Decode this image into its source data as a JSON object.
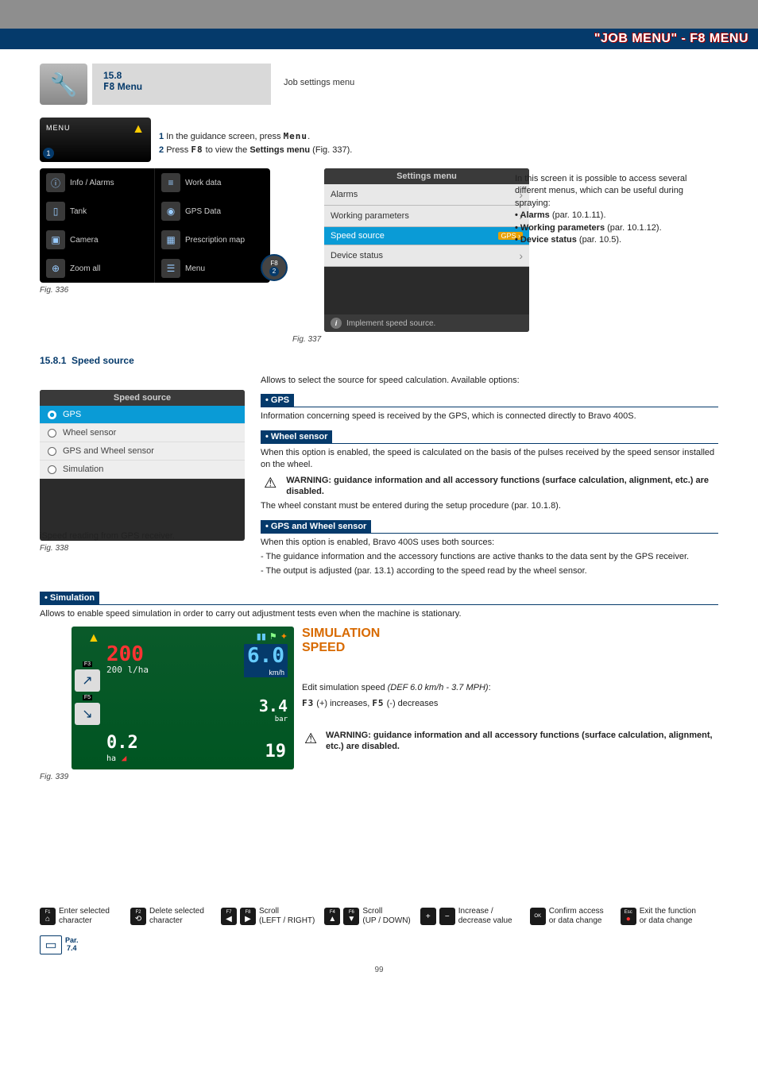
{
  "banner": "\"JOB MENU\" - F8 MENU",
  "section": {
    "num": "15.8",
    "f8": "F8",
    "menu": "Menu",
    "caption": "Job settings menu"
  },
  "menu_panel": {
    "label": "MENU",
    "badge": "1"
  },
  "instructions": {
    "s1n": "1",
    "s1a": "In the guidance screen, press ",
    "s1b": "Menu",
    "s1c": ".",
    "s2n": "2",
    "s2a": "Press ",
    "s2b": "F8",
    "s2c": " to view the ",
    "s2d": "Settings menu",
    "s2e": " (Fig. 337)."
  },
  "fig336": "Fig. 336",
  "fig337": "Fig. 337",
  "fig338": "Fig. 338",
  "fig339": "Fig. 339",
  "jobmenu": {
    "info": "Info / Alarms",
    "work": "Work data",
    "tank": "Tank",
    "gps": "GPS Data",
    "camera": "Camera",
    "rx": "Prescription map",
    "zoom": "Zoom all",
    "menu": "Menu",
    "f8": "F8",
    "n2": "2"
  },
  "settings": {
    "title": "Settings menu",
    "alarms": "Alarms",
    "wp": "Working parameters",
    "ss": "Speed source",
    "ssbadge": "GPS ›",
    "ds": "Device status",
    "hint": "Implement speed source."
  },
  "side": {
    "intro": "In this screen it is possible to access several different menus, which can be useful during spraying:",
    "b1": "• Alarms",
    "b1r": " (par. 10.1.11).",
    "b2": "• Working parameters",
    "b2r": " (par. 10.1.12).",
    "b3": "• Device status",
    "b3r": " (par. 10.5)."
  },
  "subsection": {
    "num": "15.8.1",
    "title": "Speed source"
  },
  "speed_panel": {
    "title": "Speed source",
    "gps": "GPS",
    "ws": "Wheel sensor",
    "both": "GPS and Wheel sensor",
    "sim": "Simulation",
    "hint": "Speed reading from GPS receiver."
  },
  "r": {
    "intro": "Allows to select the source for speed calculation. Available options:",
    "gps_h": "• GPS",
    "gps_p": "Information concerning speed is received by the GPS, which is connected directly to Bravo 400S.",
    "ws_h": "• Wheel sensor",
    "ws_p": "When this option is enabled, the speed is calculated on the basis of the pulses received by the speed sensor installed on the wheel.",
    "warn": "WARNING: guidance information and all accessory functions (surface calculation, alignment, etc.) are disabled.",
    "ws_p2": "The wheel constant must be entered during the setup procedure (par. 10.1.8).",
    "gw_h": "• GPS and Wheel sensor",
    "gw_p1": "When this option is enabled, Bravo 400S uses both sources:",
    "gw_p2": "- The guidance information and the accessory functions are active thanks to the data sent by the GPS receiver.",
    "gw_p3": "- The output is adjusted (par. 13.1) according to the speed read by the wheel sensor.",
    "sim_h": "• Simulation",
    "sim_p": "Allows to enable speed simulation in order to carry out adjustment tests even when the machine is stationary."
  },
  "sim": {
    "title1": "SIMULATION",
    "title2": "SPEED",
    "rate": "200",
    "rate_unit": "200 l/ha",
    "speed_v": "6.0",
    "speed_u": "km/h",
    "bar_v": "3.4",
    "bar_u": "bar",
    "ha_v": "0.2",
    "ha_u": "ha",
    "n19": "19",
    "f3": "F3",
    "f5": "F5",
    "edit1": "Edit simulation speed ",
    "edit1i": "(DEF 6.0 km/h - 3.7 MPH)",
    "edit1c": ":",
    "edit2a": "F3",
    "edit2b": " (+) increases, ",
    "edit2c": "F5",
    "edit2d": " (-) decreases"
  },
  "footer": {
    "f1": "F1",
    "f1d": "Enter selected character",
    "f2": "F2",
    "f2d": "Delete selected character",
    "f7": "F7",
    "f8": "F8",
    "lrd": "Scroll",
    "lrd2": "(LEFT / RIGHT)",
    "f4": "F4",
    "f6": "F6",
    "udd": "Scroll",
    "udd2": "(UP / DOWN)",
    "pm": "Increase / decrease value",
    "ok": "OK",
    "okd": "Confirm access or data change",
    "esc": "Esc",
    "escd": "Exit the function or data change",
    "par": "Par.",
    "parnum": "7.4"
  },
  "pagenum": "99"
}
